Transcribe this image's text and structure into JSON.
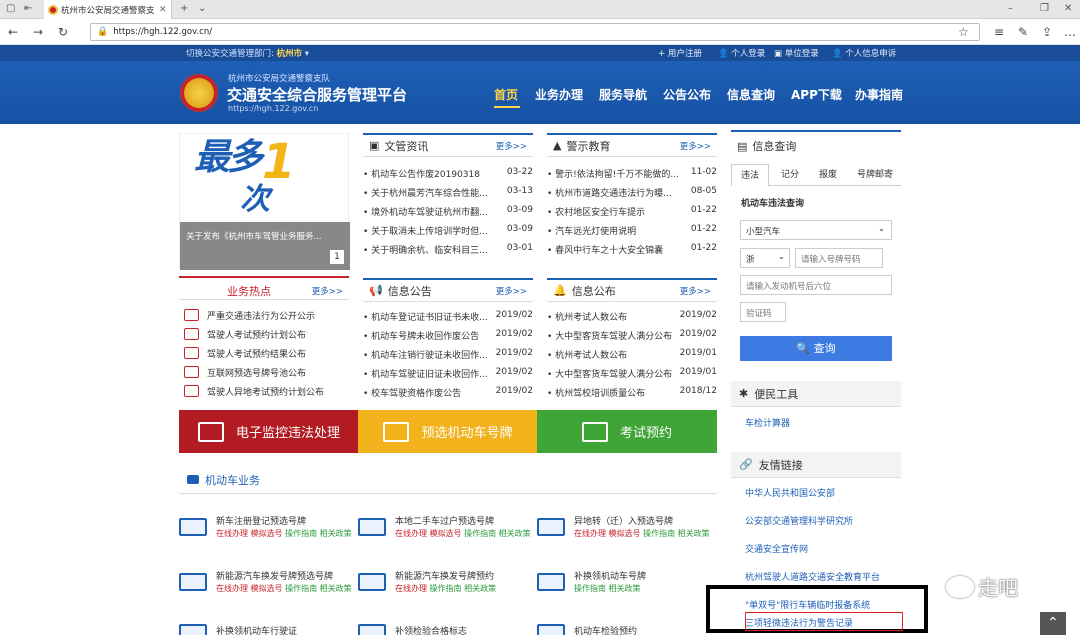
{
  "browser": {
    "tab_title": "杭州市公安局交通警察支",
    "url": "https://hgh.122.gov.cn/"
  },
  "topstrip": {
    "region_label": "切换公安交通管理部门:",
    "region_value": "杭州市",
    "links": [
      "用户注册",
      "个人登录",
      "单位登录",
      "个人信息申诉"
    ]
  },
  "header": {
    "org": "杭州市公安局交通警察支队",
    "title": "交通安全综合服务管理平台",
    "url": "https://hgh.122.gov.cn",
    "nav": [
      "首页",
      "业务办理",
      "服务导航",
      "公告公布",
      "信息查询",
      "APP下载",
      "办事指南"
    ]
  },
  "banner": {
    "caption": "关于发布《杭州市车驾管业务服务...",
    "page": "1"
  },
  "news": {
    "title": "文管资讯",
    "more": "更多>>",
    "items": [
      {
        "text": "• 机动车公告作废20190318",
        "date": "03-22"
      },
      {
        "text": "• 关于杭州晨芳汽车综合性能...",
        "date": "03-13"
      },
      {
        "text": "• 境外机动车驾驶证杭州市翻...",
        "date": "03-09"
      },
      {
        "text": "• 关于取消未上传培训学时但...",
        "date": "03-09"
      },
      {
        "text": "• 关于明确余杭、临安科目三...",
        "date": "03-01"
      }
    ]
  },
  "warning": {
    "title": "警示教育",
    "more": "更多>>",
    "items": [
      {
        "text": "• 警示!依法拘留!千万不能做的...",
        "date": "11-02"
      },
      {
        "text": "• 杭州市道路交通违法行为曝...",
        "date": "08-05"
      },
      {
        "text": "• 农村地区安全行车提示",
        "date": "01-22"
      },
      {
        "text": "• 汽车远光灯使用说明",
        "date": "01-22"
      },
      {
        "text": "• 春风中行车之十大安全锦囊",
        "date": "01-22"
      }
    ]
  },
  "notice": {
    "title": "信息公告",
    "more": "更多>>",
    "items": [
      {
        "text": "• 机动车登记证书旧证书未收...",
        "date": "2019/02"
      },
      {
        "text": "• 机动车号牌未收回作废公告",
        "date": "2019/02"
      },
      {
        "text": "• 机动车注销行驶证未收回作...",
        "date": "2019/02"
      },
      {
        "text": "• 机动车驾驶证旧证未收回作...",
        "date": "2019/02"
      },
      {
        "text": "• 校车驾驶资格作废公告",
        "date": "2019/02"
      }
    ]
  },
  "publish": {
    "title": "信息公布",
    "more": "更多>>",
    "items": [
      {
        "text": "• 杭州考试人数公布",
        "date": "2019/02"
      },
      {
        "text": "• 大中型客货车驾驶人满分公布",
        "date": "2019/02"
      },
      {
        "text": "• 杭州考试人数公布",
        "date": "2019/01"
      },
      {
        "text": "• 大中型客货车驾驶人满分公布",
        "date": "2019/01"
      },
      {
        "text": "• 杭州驾校培训质量公布",
        "date": "2018/12"
      }
    ]
  },
  "hot": {
    "title": "业务热点",
    "more": "更多>>",
    "items": [
      "严重交通违法行为公开公示",
      "驾驶人考试预约计划公布",
      "驾驶人考试预约结果公布",
      "互联网预选号牌号池公布",
      "驾驶人异地考试预约计划公布"
    ]
  },
  "big_buttons": [
    {
      "label": "电子监控违法处理",
      "color": "#b31b22"
    },
    {
      "label": "预选机动车号牌",
      "color": "#f2b21c"
    },
    {
      "label": "考试预约",
      "color": "#3fa536"
    }
  ],
  "vehicle_business": {
    "title": "机动车业务",
    "services": [
      {
        "name": "新车注册登记预选号牌",
        "links": [
          "在线办理",
          "模拟选号",
          "操作指南",
          "相关政策"
        ]
      },
      {
        "name": "本地二手车过户预选号牌",
        "links": [
          "在线办理",
          "模拟选号",
          "操作指南",
          "相关政策"
        ]
      },
      {
        "name": "异地转（迁）入预选号牌",
        "links": [
          "在线办理",
          "模拟选号",
          "操作指南",
          "相关政策"
        ]
      },
      {
        "name": "新能源汽车换发号牌预选号牌",
        "links": [
          "在线办理",
          "模拟选号",
          "操作指南",
          "相关政策"
        ]
      },
      {
        "name": "新能源汽车换发号牌预约",
        "links": [
          "在线办理",
          "操作指南",
          "相关政策"
        ]
      },
      {
        "name": "补换领机动车号牌",
        "links": [
          "操作指南",
          "相关政策"
        ]
      },
      {
        "name": "补换领机动车行驶证",
        "links": []
      },
      {
        "name": "补领检验合格标志",
        "links": []
      },
      {
        "name": "机动车检验预约",
        "links": []
      }
    ]
  },
  "info_query": {
    "title": "信息查询",
    "tabs": [
      "违法",
      "记分",
      "报废",
      "号牌邮寄"
    ],
    "subtitle": "机动车违法查询",
    "vehicle_type": "小型汽车",
    "province": "浙",
    "plate_placeholder": "请输入号牌号码",
    "engine_placeholder": "请输入发动机号后六位",
    "captcha_placeholder": "验证码",
    "query_label": "查询"
  },
  "tools": {
    "title": "便民工具",
    "items": [
      "车检计算器"
    ]
  },
  "friend_links": {
    "title": "友情链接",
    "items": [
      "中华人民共和国公安部",
      "公安部交通管理科学研究所",
      "交通安全宣传网",
      "杭州驾驶人道路交通安全教育平台",
      "\"单双号\"限行车辆临时报备系统",
      "三项轻微违法行为警告记录"
    ]
  },
  "watermark": "走吧"
}
